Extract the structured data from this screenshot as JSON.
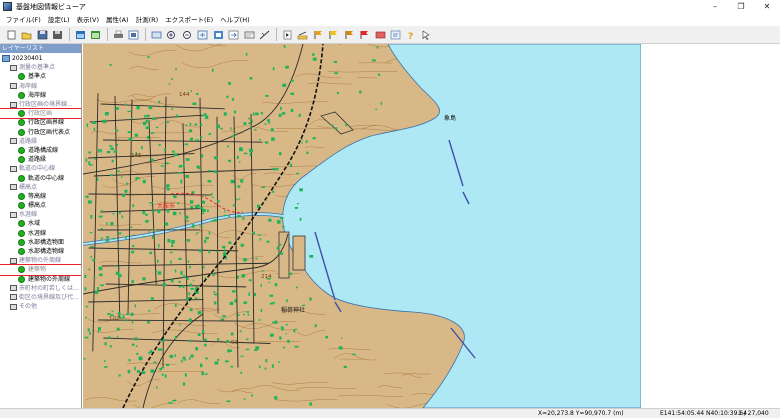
{
  "window": {
    "title": "基盤地図情報ビューア",
    "controls": {
      "minimize": "–",
      "maximize": "❐",
      "close": "✕"
    }
  },
  "menu": [
    "ファイル(F)",
    "設定(L)",
    "表示(V)",
    "属性(A)",
    "計測(R)",
    "エクスポート(E)",
    "ヘルプ(H)"
  ],
  "toolbar": {
    "buttons": [
      "new-icon",
      "open-icon",
      "save-icon",
      "save-as-icon",
      "layer-icon",
      "layer2-icon",
      "print-icon",
      "print-preview-icon",
      "rect-select-icon",
      "zoom-in-icon",
      "zoom-out-icon",
      "zoom-full-icon",
      "zoom-window-icon",
      "pan-icon",
      "identify-icon",
      "measure-icon",
      "select-icon",
      "line-tool-icon",
      "flag1-icon",
      "flag2-icon",
      "flag3-icon",
      "red-flag-icon",
      "marker-icon",
      "help-icon",
      "cursor-help-icon"
    ]
  },
  "sidebar": {
    "header": "レイヤーリスト",
    "root": "20230401",
    "items": [
      {
        "label": "測量の基準点",
        "level": 1,
        "type": "category"
      },
      {
        "label": "基準点",
        "level": 2,
        "type": "layer"
      },
      {
        "label": "海岸線",
        "level": 1,
        "type": "category"
      },
      {
        "label": "海岸線",
        "level": 2,
        "type": "layer"
      },
      {
        "label": "行政区画の境界線...",
        "level": 1,
        "type": "category"
      },
      {
        "label": "行政区画",
        "level": 2,
        "type": "layer",
        "highlight": true
      },
      {
        "label": "行政区画界線",
        "level": 2,
        "type": "layer"
      },
      {
        "label": "行政区画代表点",
        "level": 2,
        "type": "layer"
      },
      {
        "label": "道路縁",
        "level": 1,
        "type": "category"
      },
      {
        "label": "道路構成線",
        "level": 2,
        "type": "layer"
      },
      {
        "label": "道路縁",
        "level": 2,
        "type": "layer"
      },
      {
        "label": "軌道の中心線",
        "level": 1,
        "type": "category"
      },
      {
        "label": "軌道の中心線",
        "level": 2,
        "type": "layer"
      },
      {
        "label": "標高点",
        "level": 1,
        "type": "category"
      },
      {
        "label": "等高線",
        "level": 2,
        "type": "layer"
      },
      {
        "label": "標高点",
        "level": 2,
        "type": "layer"
      },
      {
        "label": "水涯線",
        "level": 1,
        "type": "category"
      },
      {
        "label": "水域",
        "level": 2,
        "type": "layer"
      },
      {
        "label": "水涯線",
        "level": 2,
        "type": "layer"
      },
      {
        "label": "水部構造物面",
        "level": 2,
        "type": "layer"
      },
      {
        "label": "水部構造物線",
        "level": 2,
        "type": "layer"
      },
      {
        "label": "建築物の外周線",
        "level": 1,
        "type": "category"
      },
      {
        "label": "建築物",
        "level": 2,
        "type": "layer",
        "highlight": true
      },
      {
        "label": "建築物の外周線",
        "level": 2,
        "type": "layer"
      },
      {
        "label": "市町村の町若しくは...",
        "level": 1,
        "type": "category"
      },
      {
        "label": "街区の境界線及び代...",
        "level": 1,
        "type": "category"
      },
      {
        "label": "その他",
        "level": 1,
        "type": "category"
      }
    ]
  },
  "map": {
    "labels": [
      {
        "text": "象島",
        "kind": "place"
      },
      {
        "text": "稲荷神社",
        "kind": "place"
      },
      {
        "text": "大館市",
        "kind": "admin"
      },
      {
        "text": "146",
        "kind": "elev"
      },
      {
        "text": "102",
        "kind": "elev"
      },
      {
        "text": "214",
        "kind": "elev"
      },
      {
        "text": "93",
        "kind": "elev"
      },
      {
        "text": "144",
        "kind": "elev"
      }
    ],
    "colors": {
      "land": "#d9b888",
      "sea": "#aee8f4",
      "building": "#1db35a",
      "road": "#2a2a2a",
      "contour": "#a06a2a",
      "boundary": "#e8202a"
    }
  },
  "status": {
    "xy": "X=20,273.8 Y=90,970.7 (m)",
    "lonlat": "E141:54:05.44 N40:10:39.64",
    "scale": "1 / 27,040"
  }
}
